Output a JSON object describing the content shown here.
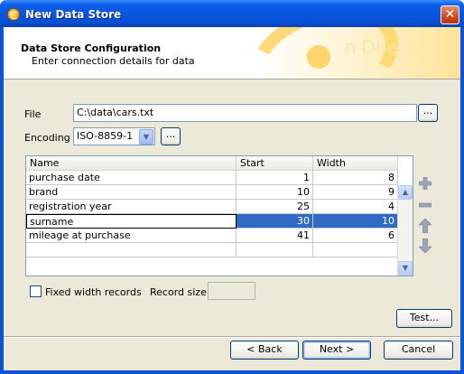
{
  "window": {
    "title": "New Data Store",
    "close_label": "✕"
  },
  "header": {
    "title": "Data Store Configuration",
    "subtitle": "Enter connection details for data",
    "brand_fragment": "n Director"
  },
  "file": {
    "label": "File",
    "value": "C:\\data\\cars.txt",
    "browse_label": "..."
  },
  "encoding": {
    "label": "Encoding",
    "value": "ISO-8859-1",
    "browse_label": "..."
  },
  "table": {
    "columns": [
      "Name",
      "Start",
      "Width"
    ],
    "rows": [
      {
        "name": "purchase date",
        "start": "1",
        "width": "8"
      },
      {
        "name": "brand",
        "start": "10",
        "width": "9"
      },
      {
        "name": "registration year",
        "start": "25",
        "width": "4"
      },
      {
        "name": "surname",
        "start": "30",
        "width": "10"
      },
      {
        "name": "mileage at purchase",
        "start": "41",
        "width": "6"
      }
    ],
    "selected_row": 3
  },
  "side_icons": [
    "add-icon",
    "remove-icon",
    "move-up-icon",
    "move-down-icon"
  ],
  "options": {
    "fixed_width_label": "Fixed width records",
    "fixed_width_checked": false,
    "record_size_label": "Record size",
    "record_size_value": ""
  },
  "buttons": {
    "test": "Test...",
    "back": "< Back",
    "next": "Next >",
    "cancel": "Cancel"
  },
  "colors": {
    "titlebar": "#0a54d6",
    "dialog_bg": "#ece9d8",
    "selection": "#316ac5"
  }
}
